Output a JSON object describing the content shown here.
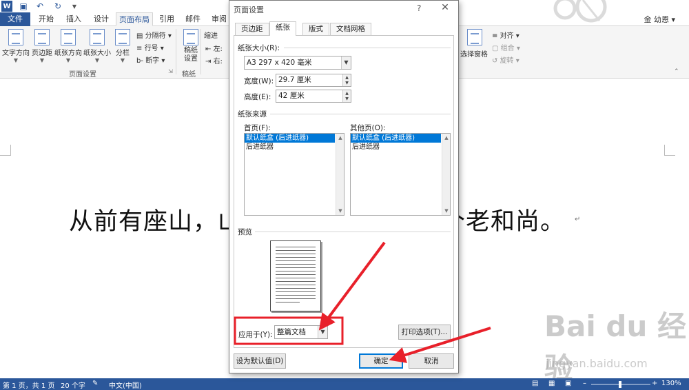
{
  "tabs": [
    "文件",
    "开始",
    "插入",
    "设计",
    "页面布局",
    "引用",
    "邮件",
    "审阅"
  ],
  "user": "金 幼恩 ▾",
  "ribbon": {
    "buttons": [
      "文字方向",
      "页边距",
      "纸张方向",
      "纸张大小",
      "分栏",
      "稿纸\n设置"
    ],
    "small": {
      "breaks": "分隔符",
      "line_numbers": "行号",
      "hyphen": "断字",
      "indent": "缩进",
      "left": "左:",
      "right": "右:",
      "align": "对齐",
      "group": "组合",
      "rotate": "旋转",
      "selection_pane": "选择窗格"
    },
    "groups": {
      "page_setup": "页面设置",
      "manuscript": "稿纸"
    }
  },
  "document": {
    "text": "从前有座山，山里有座庙，庙里有个老和尚。"
  },
  "dialog": {
    "title": "页面设置",
    "help": "?",
    "close": "✕",
    "tabs": [
      "页边距",
      "纸张",
      "版式",
      "文档网格"
    ],
    "paper_size_label": "纸张大小(R):",
    "paper_size_value": "A3 297 x 420 毫米",
    "width_label": "宽度(W):",
    "width_value": "29.7 厘米",
    "height_label": "高度(E):",
    "height_value": "42 厘米",
    "paper_source_label": "纸张来源",
    "first_page_label": "首页(F):",
    "other_pages_label": "其他页(O):",
    "tray_items": [
      "默认纸盒 (后进纸器)",
      "后进纸器"
    ],
    "preview_label": "预览",
    "apply_to_label": "应用于(Y):",
    "apply_to_value": "整篇文档",
    "print_options": "打印选项(T)...",
    "set_default": "设为默认值(D)",
    "ok": "确定",
    "cancel": "取消"
  },
  "status": {
    "page": "第 1 页，共 1 页",
    "words": "20 个字",
    "lang": "中文(中国)",
    "zoom": "130%"
  },
  "watermark": {
    "main": "Bai du 经验",
    "sub": "jingyan.baidu.com"
  },
  "colors": {
    "brand": "#2b579a",
    "selection": "#0078d7",
    "annotation": "#e8202a"
  }
}
